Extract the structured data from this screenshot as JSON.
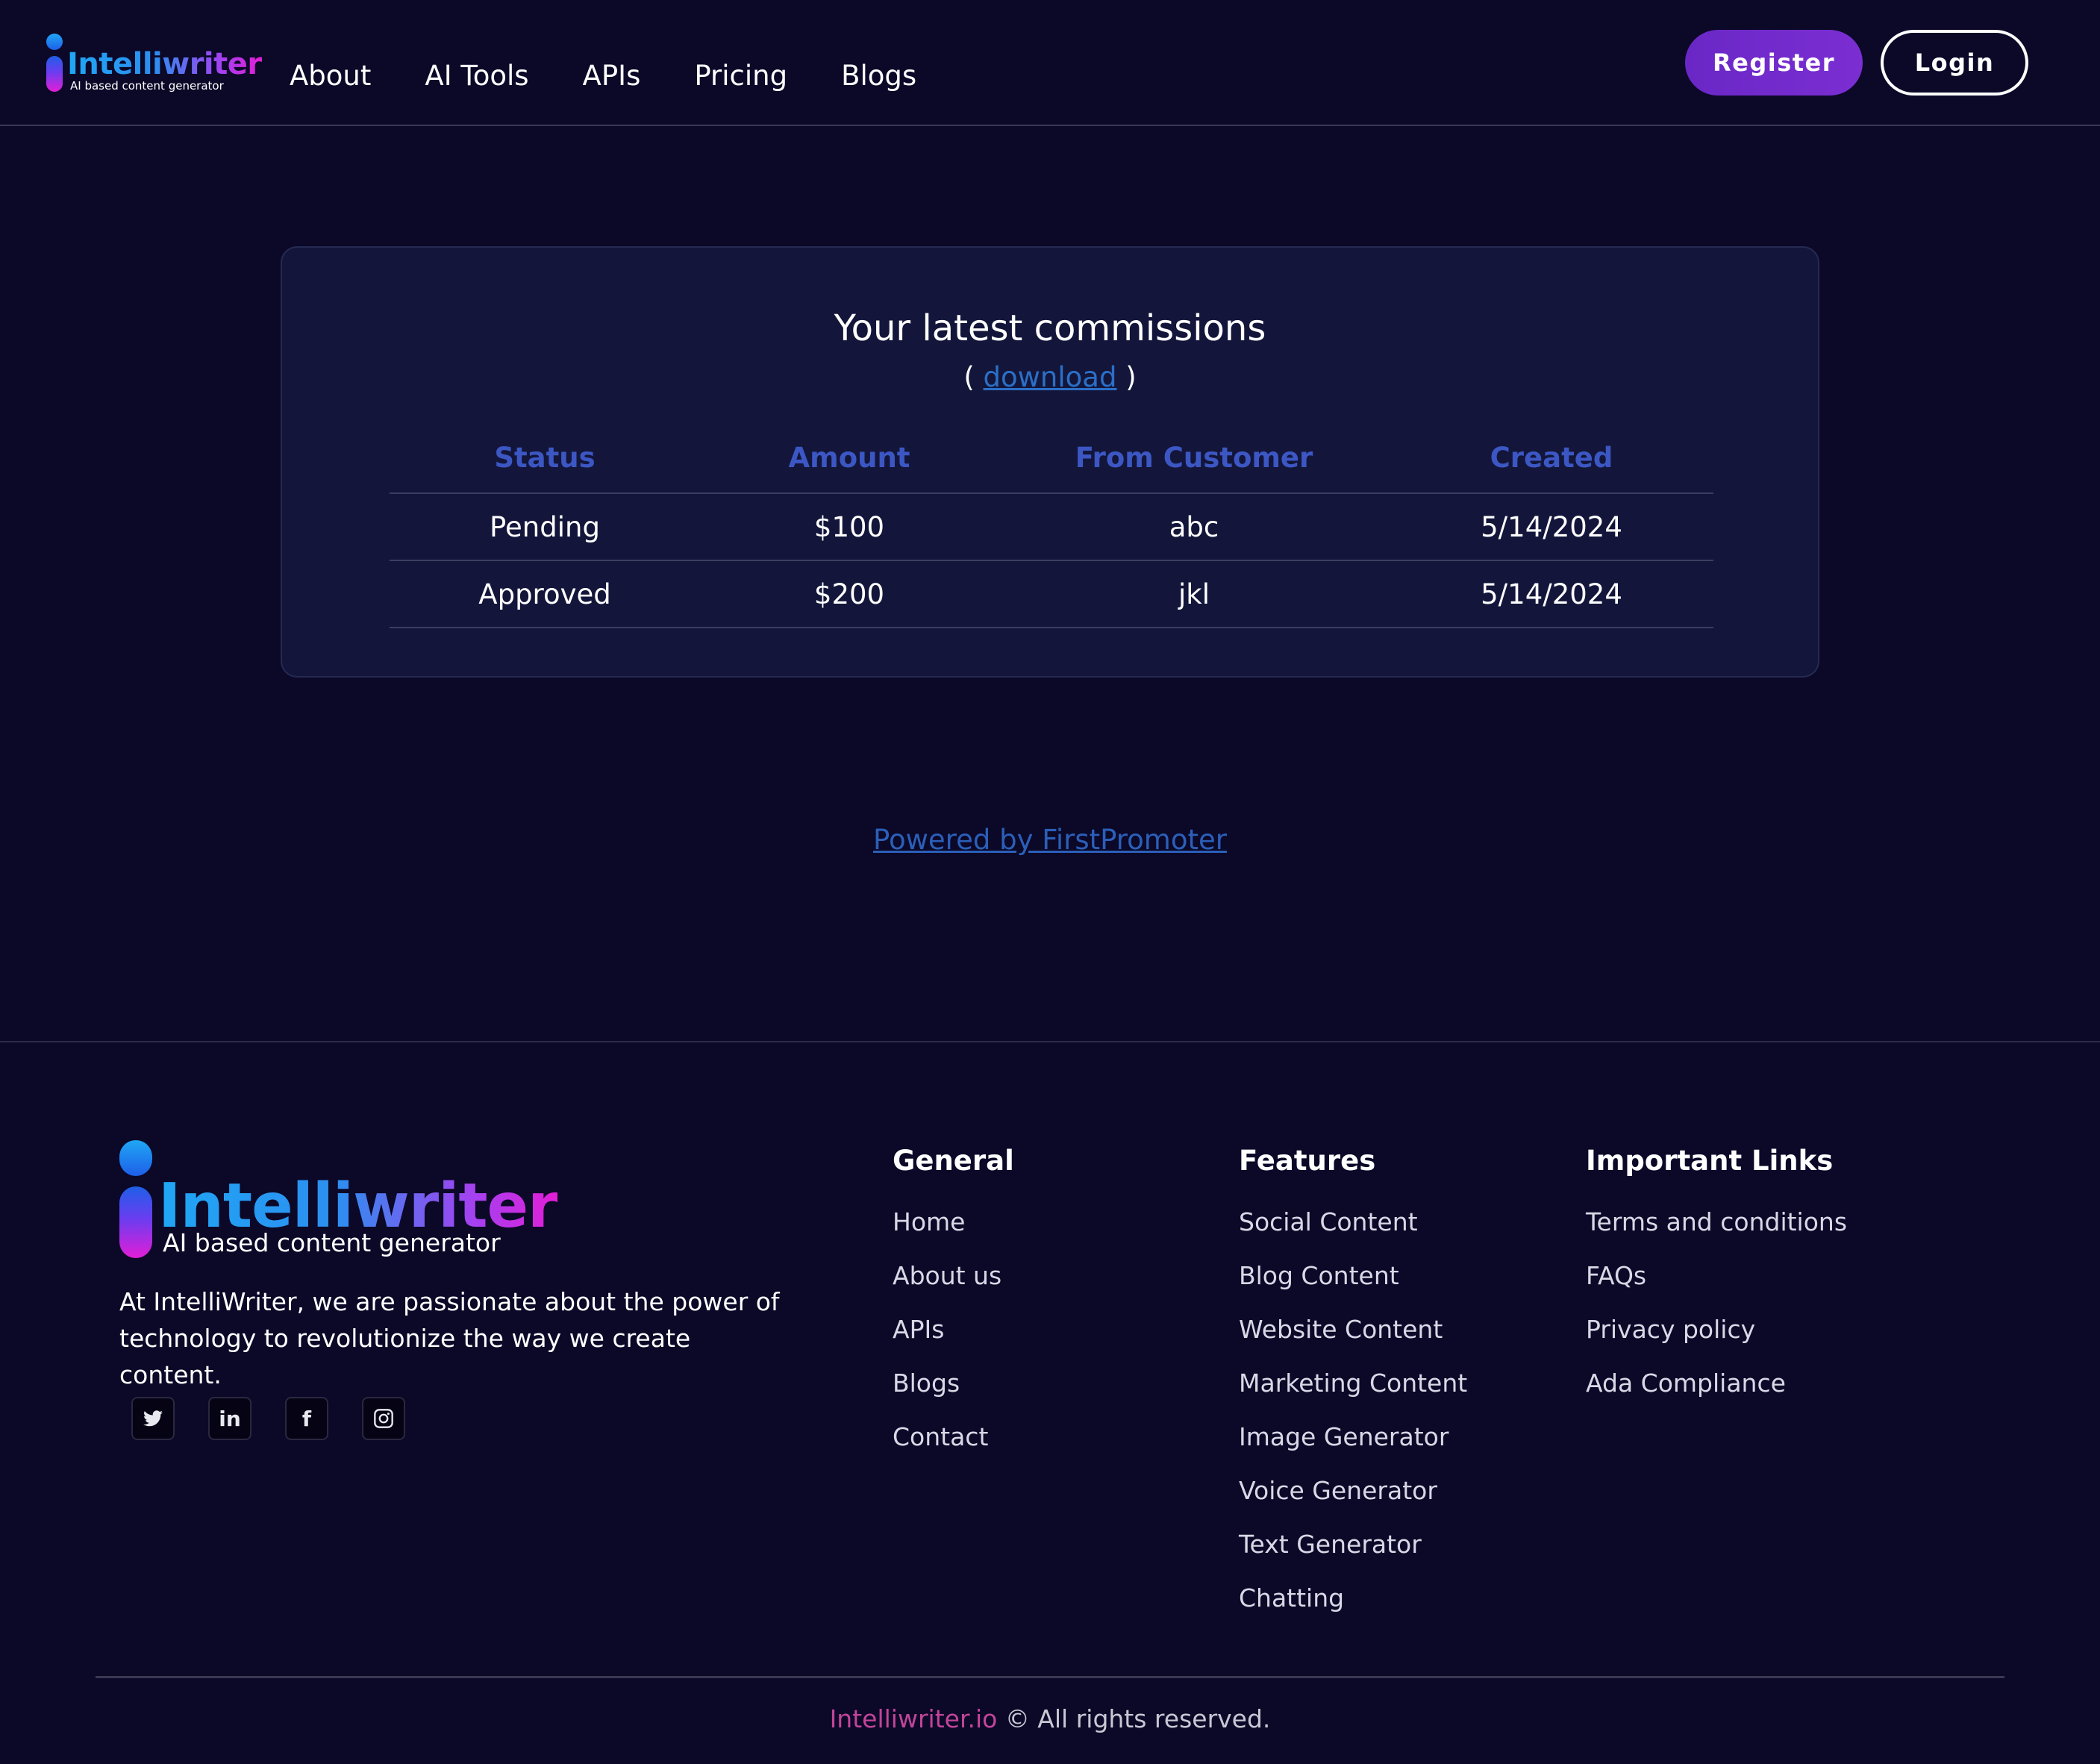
{
  "header": {
    "logo": {
      "wordmark": "Intelliwriter",
      "tagline": "AI based content generator"
    },
    "nav": [
      "About",
      "AI Tools",
      "APIs",
      "Pricing",
      "Blogs"
    ],
    "register_label": "Register",
    "login_label": "Login"
  },
  "commissions": {
    "title": "Your latest commissions",
    "download_open": "(",
    "download_label": "download",
    "download_close": ")",
    "columns": [
      "Status",
      "Amount",
      "From Customer",
      "Created"
    ],
    "rows": [
      [
        "Pending",
        "$100",
        "abc",
        "5/14/2024"
      ],
      [
        "Approved",
        "$200",
        "jkl",
        "5/14/2024"
      ]
    ]
  },
  "powered_by": "Powered by FirstPromoter",
  "footer": {
    "logo": {
      "wordmark": "Intelliwriter",
      "tagline": "AI based content generator"
    },
    "about": "At IntelliWriter, we are passionate about the power of technology to revolutionize the way we create content.",
    "socials": [
      {
        "icon": "twitter-icon",
        "glyph": "🐦"
      },
      {
        "icon": "linkedin-icon",
        "glyph": "in"
      },
      {
        "icon": "facebook-icon",
        "glyph": "f"
      },
      {
        "icon": "instagram-icon",
        "glyph": "◎"
      }
    ],
    "columns": [
      {
        "title": "General",
        "links": [
          "Home",
          "About us",
          "APIs",
          "Blogs",
          "Contact"
        ]
      },
      {
        "title": "Features",
        "links": [
          "Social Content",
          "Blog Content",
          "Website Content",
          "Marketing Content",
          "Image Generator",
          "Voice Generator",
          "Text Generator",
          "Chatting"
        ]
      },
      {
        "title": "Important Links",
        "links": [
          "Terms and conditions",
          "FAQs",
          "Privacy policy",
          "Ada Compliance"
        ]
      }
    ],
    "copyright_brand": "Intelliwriter.io",
    "copyright_rest": " © All rights reserved."
  },
  "colors": {
    "background": "#0b0828",
    "card": "#13163a",
    "accent_purple": "#6a27c6",
    "table_header": "#3c57c4",
    "link_blue": "#2b6fc7",
    "brand_pink": "#c2459a"
  }
}
